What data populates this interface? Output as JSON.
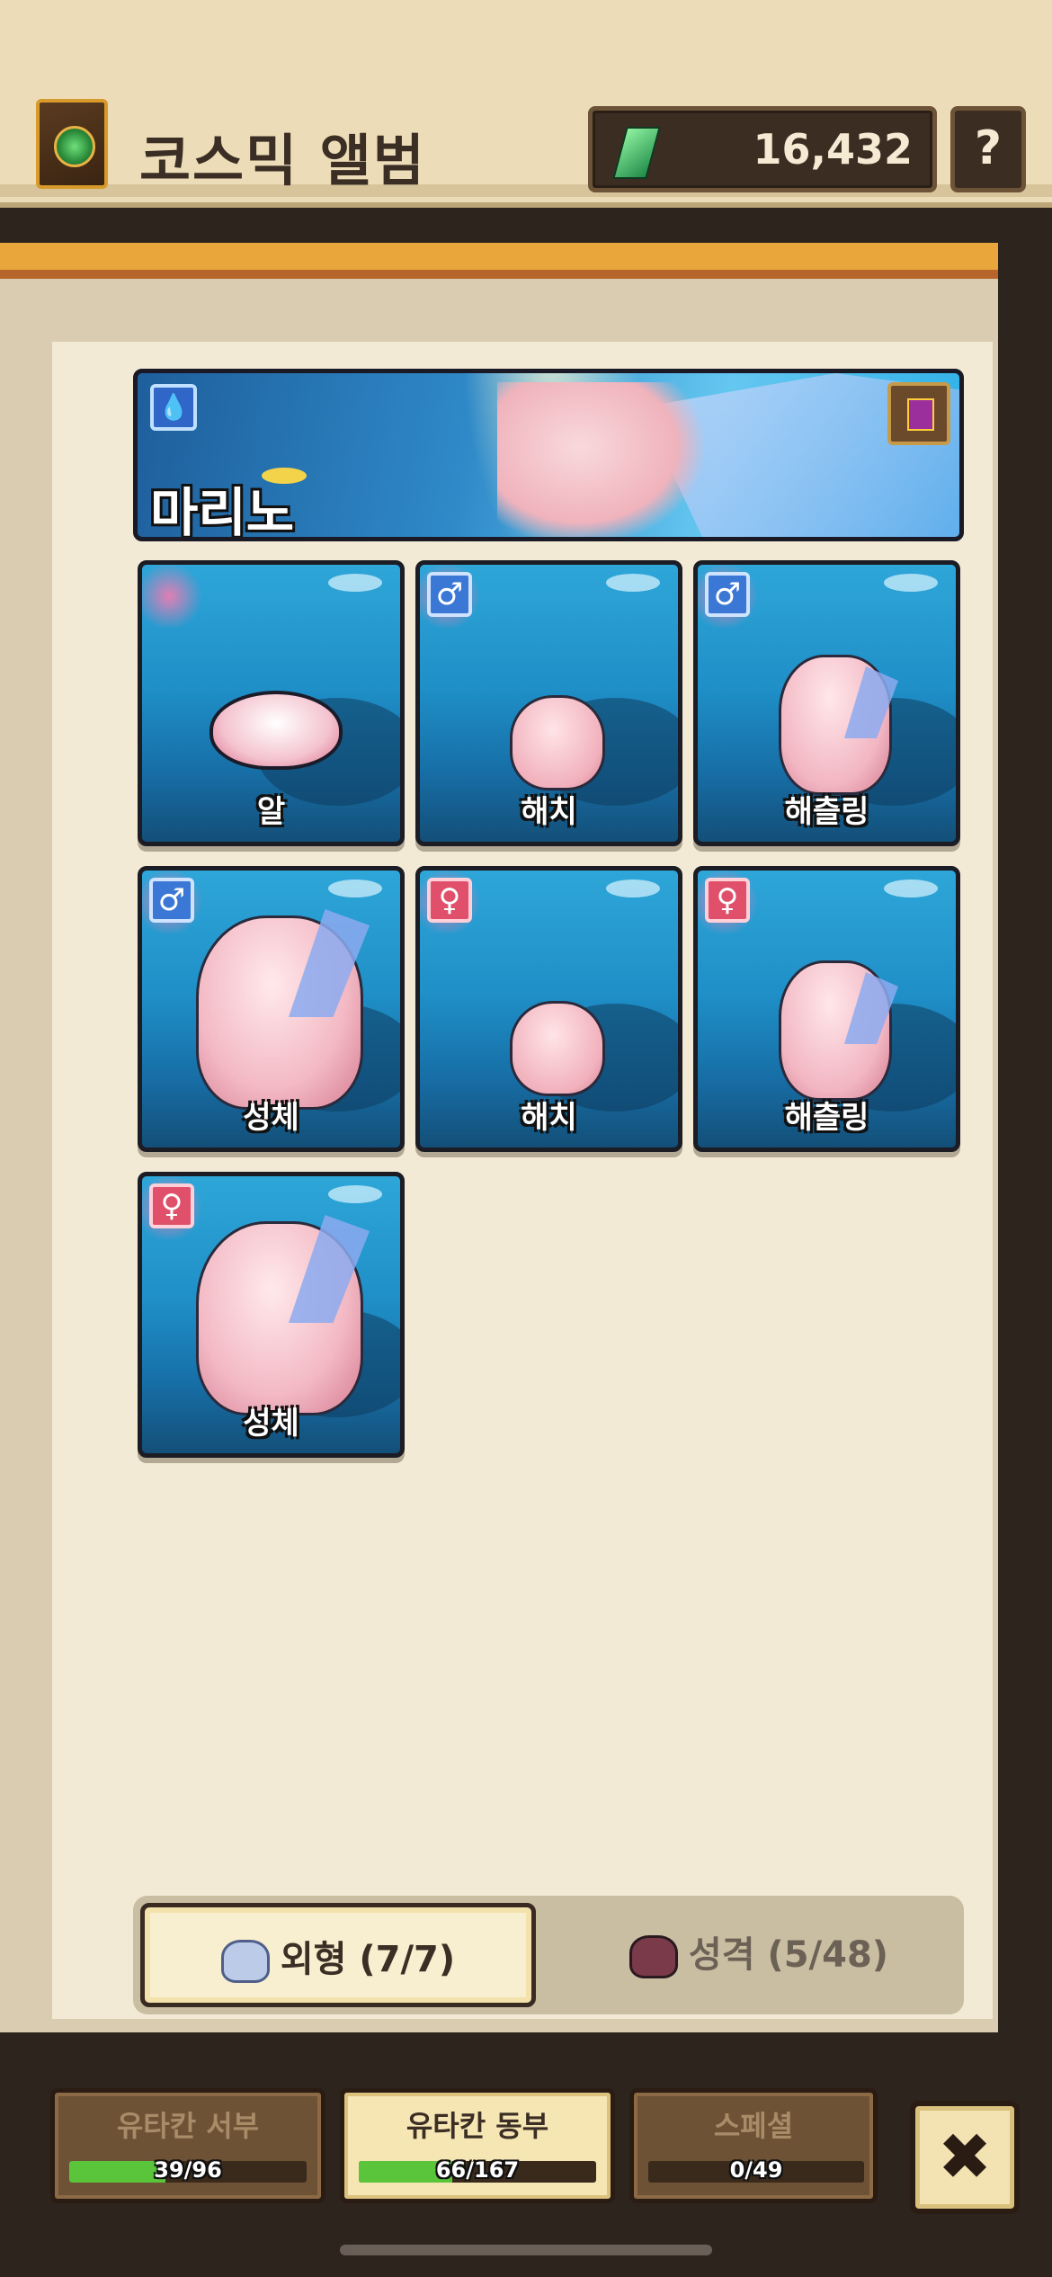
{
  "header": {
    "title": "코스믹 앨범",
    "currency_value": "16,432",
    "help_label": "?"
  },
  "dragon": {
    "name": "마리노",
    "element_icon": "water-drop-icon",
    "element_glyph": "💧"
  },
  "cards": [
    {
      "label": "알",
      "gender": null
    },
    {
      "label": "해치",
      "gender": "male",
      "gender_glyph": "♂"
    },
    {
      "label": "해츨링",
      "gender": "male",
      "gender_glyph": "♂"
    },
    {
      "label": "성체",
      "gender": "male",
      "gender_glyph": "♂"
    },
    {
      "label": "해치",
      "gender": "female",
      "gender_glyph": "♀"
    },
    {
      "label": "해츨링",
      "gender": "female",
      "gender_glyph": "♀"
    },
    {
      "label": "성체",
      "gender": "female",
      "gender_glyph": "♀"
    }
  ],
  "tabs": {
    "appearance": "외형 (7/7)",
    "personality": "성격 (5/48)"
  },
  "regions": [
    {
      "name": "유타칸 서부",
      "count": "39/96",
      "progress": 0.406
    },
    {
      "name": "유타칸 동부",
      "count": "66/167",
      "progress": 0.395
    },
    {
      "name": "스페셜",
      "count": "0/49",
      "progress": 0
    }
  ],
  "close_label": "✖",
  "colors": {
    "water_accent": "#2f66c8",
    "male": "#3b78d6",
    "female": "#e0506a",
    "progress_green": "#5ac43a"
  }
}
